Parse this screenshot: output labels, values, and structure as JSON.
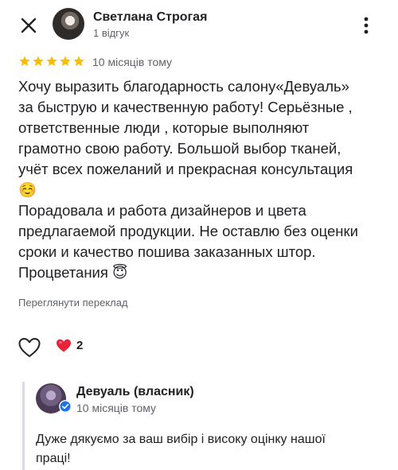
{
  "header": {
    "author_name": "Светлана Строгая",
    "author_meta": "1 відгук",
    "close_icon": "close-icon",
    "more_icon": "more-vertical-icon"
  },
  "rating": {
    "stars": 5,
    "max_stars": 5,
    "date": "10 місяців тому",
    "star_color": "#fbbc04"
  },
  "review": {
    "text": "Хочу выразить благодарность салону«Девуаль»\nза быструю и качественную работу! Серьёзные ,\nответственные люди , которые выполняют\nграмотно свою работу. Большой выбор тканей,\nучёт всех пожеланий и прекрасная консультация\n☺️\nПорадовала и работа дизайнеров и цвета\nпредлагаемой продукции. Не оставлю без оценки\nсроки и качество пошива заказанных штор.\nПроцветания 😇",
    "translate_label": "Переглянути переклад"
  },
  "reactions": {
    "like_icon": "heart-outline-icon",
    "reaction_icon": "heart-emoji",
    "reaction_emoji": "❤️",
    "reaction_count": "2"
  },
  "owner_reply": {
    "name": "Девуаль (власник)",
    "date": "10 місяців тому",
    "text": "Дуже дякуємо за ваш вибір і високу оцінку нашої\nпраці!",
    "badge_color": "#1a73e8"
  }
}
